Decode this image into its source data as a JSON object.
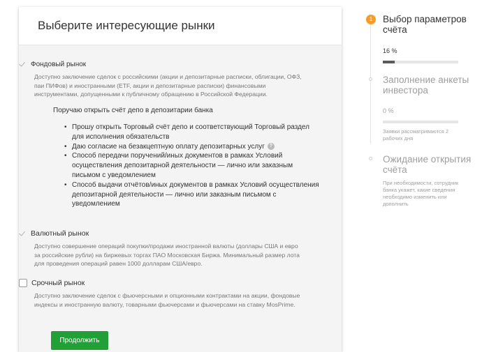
{
  "form": {
    "title": "Выберите интересующие рынки",
    "stock": {
      "label": "Фондовый рынок",
      "checked": true,
      "description": "Доступно заключение сделок с российскими (акции и депозитарные расписки, облигации, ОФЗ, паи ПИФов) и иностранными (ETF, акции и депозитарные расписки) финансовыми инструментами, допущенными к публичному обращению в Российской Федерации.",
      "depo_title": "Поручаю открыть счёт депо в депозитарии банка",
      "bullets": [
        "Прошу открыть Торговый счёт депо и соответствующий Торговый раздел для исполнения обязательств",
        "Даю согласие на безакцептную оплату депозитарных услуг",
        "Способ передачи поручений/иных документов в рамках Условий осуществления депозитарной деятельности — лично или заказным письмом с уведомлением",
        "Способ выдачи отчётов/иных документов в рамках Условий осуществления депозитарной деятельности — лично или заказным письмом с уведомлением"
      ],
      "help_icon": "?"
    },
    "currency": {
      "label": "Валютный рынок",
      "checked": true,
      "description": "Доступно совершение операций покупки/продажи иностранной валюты (доллары США и евро за российские рубли) на биржевых торгах ПАО Московская Биржа. Минимальный размер лота для проведения операций равен 1000 долларам США/евро."
    },
    "futures": {
      "label": "Срочный рынок",
      "checked": false,
      "description": "Доступно заключение сделок с фьючерсными и опционными контрактами на акции, фондовые индексы и иностранную валюту, товарными фьючерсами и фьючерсами на ставку MosPrime."
    },
    "continue_label": "Продолжить",
    "accent_color": "#21a038"
  },
  "steps": [
    {
      "number": "1",
      "title": "Выбор параметров счёта",
      "progress_text": "16 %",
      "progress": 0.16
    },
    {
      "title": "Заполнение анкеты инвестора",
      "progress_text": "0 %",
      "progress": 0,
      "note": "Заявки рассматриваются 2 рабочих дня"
    },
    {
      "title": "Ожидание открытия счёта",
      "note": "При необходимости, сотрудник банка укажет, какие сведения необходимо изменить или дополнить"
    }
  ],
  "step_badge_color": "#f59c2a"
}
